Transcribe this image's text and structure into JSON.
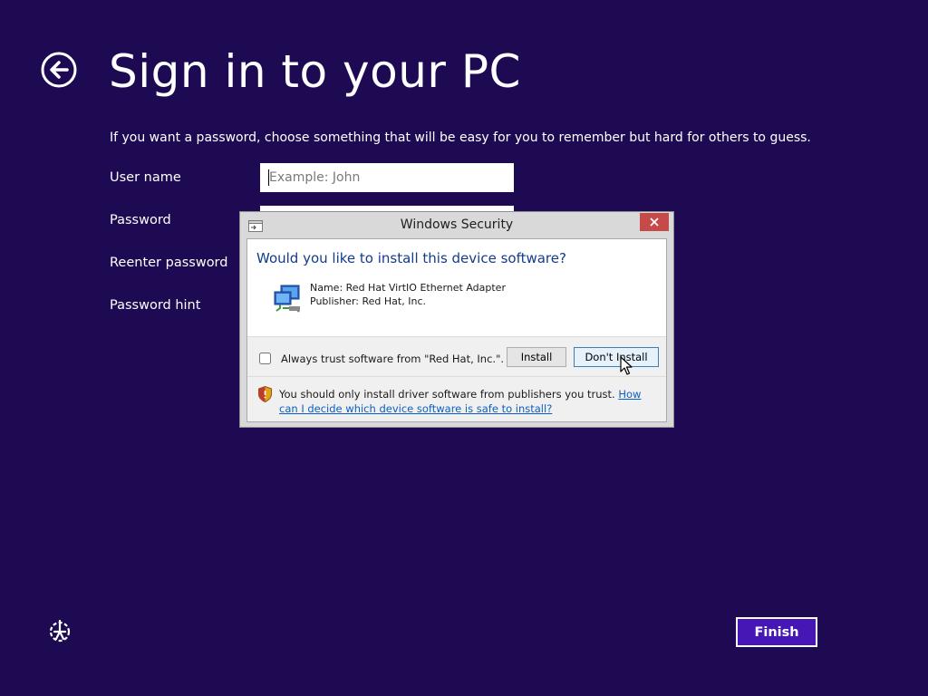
{
  "page": {
    "title": "Sign in to your PC",
    "intro": "If you want a password, choose something that will be easy for you to remember but hard for others to guess.",
    "fields": {
      "username_label": "User name",
      "username_placeholder": "Example: John",
      "password_label": "Password",
      "reenter_label": "Reenter password",
      "hint_label": "Password hint"
    },
    "finish_label": "Finish",
    "background_color": "#1d0a52",
    "accent_color": "#4617b4"
  },
  "dialog": {
    "title": "Windows Security",
    "question": "Would you like to install this device software?",
    "name_line": "Name: Red Hat VirtIO Ethernet Adapter",
    "publisher_line": "Publisher: Red Hat, Inc.",
    "always_trust_label": "Always trust software from \"Red Hat, Inc.\".",
    "install_label": "Install",
    "dont_install_label": "Don't Install",
    "warning_text": "You should only install driver software from publishers you trust.",
    "link_text": "How can I decide which device software is safe to install?",
    "icons": [
      "app-icon",
      "close-icon",
      "network-adapter-icon",
      "shield-warning-icon",
      "mouse-cursor-icon"
    ]
  }
}
